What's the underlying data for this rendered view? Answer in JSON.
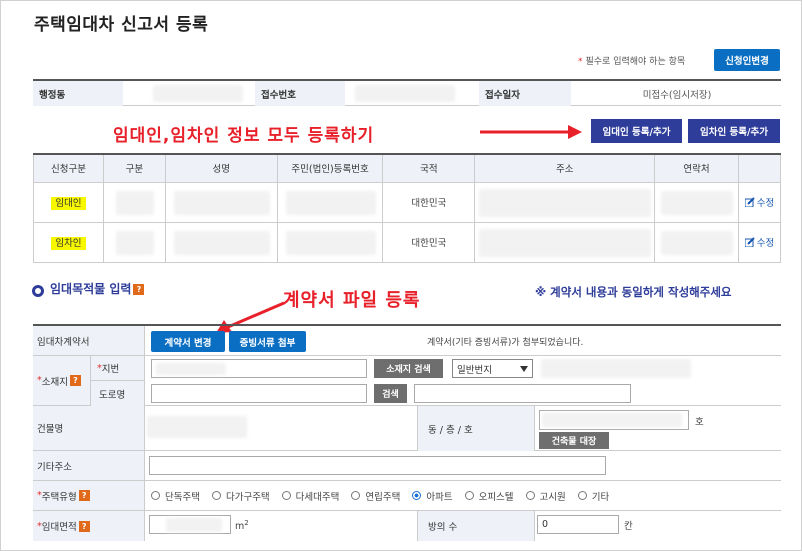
{
  "page": {
    "title": "주택임대차 신고서 등록",
    "required_note_star": "*",
    "required_note": "필수로 입력해야 하는 항목",
    "applicant_change_button": "신청인변경"
  },
  "info_row": {
    "dong_label": "행정동",
    "receipt_no_label": "접수번호",
    "receipt_date_label": "접수일자",
    "status_value": "미접수(임시저장)"
  },
  "annotations": {
    "top": "임대인,임차인 정보 모두 등록하기",
    "contract": "계약서 파일 등록"
  },
  "party_buttons": {
    "lessor_add": "임대인 등록/추가",
    "lessee_add": "임차인 등록/추가"
  },
  "party_table": {
    "headers": [
      "신청구분",
      "구분",
      "성명",
      "주민(법인)등록번호",
      "국적",
      "주소",
      "연락처",
      ""
    ],
    "rows": [
      {
        "type": "임대인",
        "nationality": "대한민국",
        "action": "수정"
      },
      {
        "type": "임차인",
        "nationality": "대한민국",
        "action": "수정"
      }
    ]
  },
  "section": {
    "title": "임대목적물 입력",
    "help": "?",
    "notice": "※ 계약서 내용과 동일하게 작성해주세요"
  },
  "form": {
    "contract_label": "임대차계약서",
    "contract_change_button": "계약서 변경",
    "evidence_attach_button": "증빙서류 첨부",
    "contract_status": "계약서(기타 증빙서류)가 첨부되었습니다.",
    "location_label": "소재지",
    "lot_label": "지번",
    "location_search_button": "소재지 검색",
    "lot_type_select": "일반번지",
    "road_label": "도로명",
    "search_button": "검색",
    "building_name_label": "건물명",
    "dong_floor_ho_label": "동 / 층 / 호",
    "ho_unit": "호",
    "building_register_button": "건축물 대장",
    "other_address_label": "기타주소",
    "housing_type_label": "주택유형",
    "housing_types": [
      "단독주택",
      "다가구주택",
      "다세대주택",
      "연립주택",
      "아파트",
      "오피스텔",
      "고시원",
      "기타"
    ],
    "housing_type_selected": "아파트",
    "lease_area_label": "임대면적",
    "area_unit": "m",
    "area_unit_sup": "2",
    "rooms_label": "방의 수",
    "rooms_value": "0",
    "rooms_unit": "칸",
    "req_star": "*"
  },
  "colors": {
    "primary_blue": "#0a6fc2",
    "navy": "#2f3d9a",
    "annotation_red": "#e8202a",
    "highlight_yellow": "#f7f700"
  }
}
